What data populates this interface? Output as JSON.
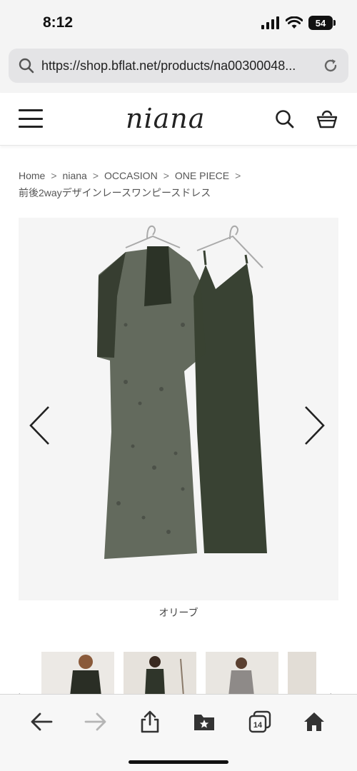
{
  "status_bar": {
    "time": "8:12",
    "battery": "54"
  },
  "browser": {
    "url": "https://shop.bflat.net/products/na00300048..."
  },
  "site": {
    "logo": "niana"
  },
  "breadcrumb": {
    "items": [
      "Home",
      "niana",
      "OCCASION",
      "ONE PIECE"
    ],
    "current": "前後2wayデザインレースワンピースドレス"
  },
  "product": {
    "color_caption": "オリーブ",
    "dress_color": "#3a4232"
  },
  "toolbar": {
    "tabs_count": "14",
    "icons": [
      "back-arrow-icon",
      "forward-arrow-icon",
      "share-icon",
      "bookmarks-icon",
      "tabs-icon",
      "home-icon"
    ]
  },
  "colors": {
    "accent": "#222222",
    "background": "#ffffff",
    "chrome": "#f4f4f4"
  }
}
